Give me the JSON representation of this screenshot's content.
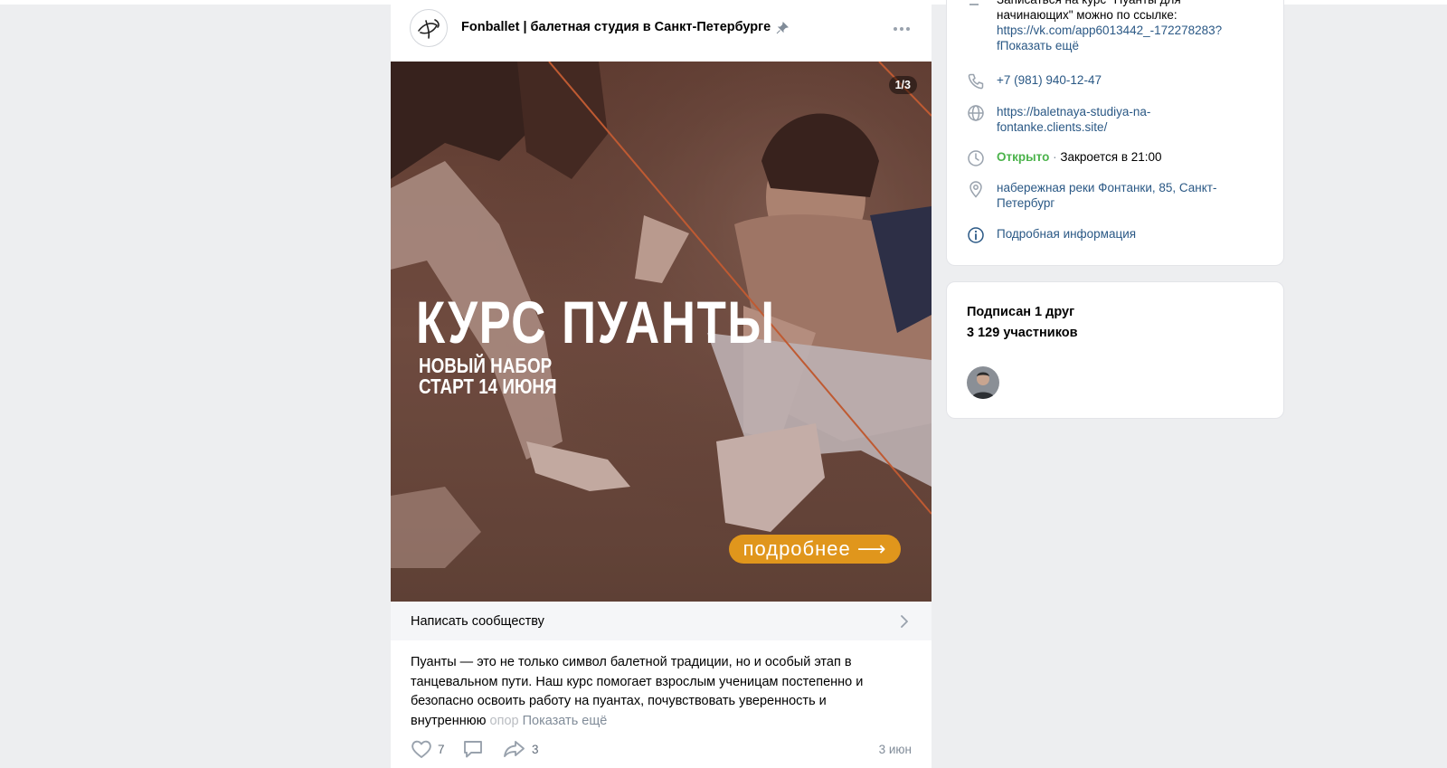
{
  "post": {
    "community_name": "Fonballet | балетная студия в Санкт-Петербурге",
    "image": {
      "counter": "1/3",
      "title": "КУРС ПУАНТЫ",
      "subtitle_1": "НОВЫЙ НАБОР",
      "subtitle_2": "СТАРТ 14 ИЮНЯ",
      "cta": "подробнее ⟶"
    },
    "write_label": "Написать сообществу",
    "text_main": "Пуанты — это не только символ балетной традиции, но и особый этап в танцевальном пути. Наш курс помогает взрослым ученицам постепенно и безопасно освоить работу на пуантах, почувствовать уверенность и внутреннюю ",
    "text_fade": "опор",
    "show_more": "Показать ещё",
    "likes": "7",
    "shares": "3",
    "date": "3 июн"
  },
  "info": {
    "top_partial_1": "Записаться на курс \"Пуанты для",
    "top_partial_2": "начинающих\" можно по ссылке:",
    "top_link_1": "https://vk.com/app6013442_-172278283?",
    "top_link_2": "f",
    "top_more": "Показать ещё",
    "phone": "+7 (981) 940-12-47",
    "site_1": "https://baletnaya-studiya-na-",
    "site_2": "fontanke.clients.site/",
    "open_status": "Открыто",
    "separator": " · ",
    "close_time": "Закроется в 21:00",
    "address_1": "набережная реки Фонтанки, 85, Санкт-",
    "address_2": "Петербург",
    "details": "Подробная информация"
  },
  "members": {
    "friends": "Подписан 1 друг",
    "count": "3 129 участников"
  },
  "icons": [
    "fonballet-logo-icon",
    "pin-icon",
    "more-icon",
    "chevron-right-icon",
    "heart-icon",
    "comment-icon",
    "share-icon",
    "phone-icon",
    "globe-icon",
    "clock-icon",
    "location-icon",
    "info-icon"
  ],
  "colors": {
    "link": "#2a5885",
    "open_green": "#4bb34b",
    "cta_orange": "#e0961c",
    "background": "#edeef0"
  }
}
